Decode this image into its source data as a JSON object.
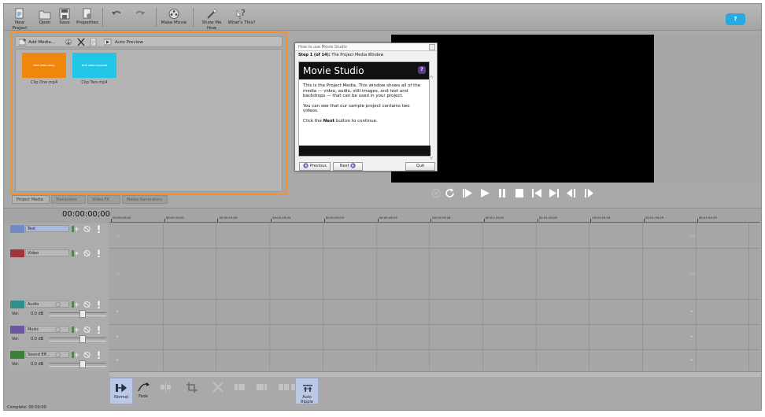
{
  "toolbar": {
    "buttons": [
      "New Project",
      "Open",
      "Save",
      "Properties",
      "",
      "",
      "Make Movie",
      "Show Me How",
      "What's This?"
    ],
    "help_badge": "?"
  },
  "media": {
    "add_media": "Add Media...",
    "auto_preview": "Auto Preview",
    "clips": [
      {
        "name": "Clip One.mp4",
        "thumb_text": "first video story",
        "color": "#f0870a"
      },
      {
        "name": "Clip Two.mp4",
        "thumb_text": "first video moment",
        "color": "#21c6e6"
      }
    ]
  },
  "tabs": [
    "Project Media",
    "Transitions",
    "Video FX",
    "Media Generators"
  ],
  "dialog": {
    "title": "How to use Movie Studio",
    "step_label": "Step 1 (of 14):",
    "step_name": "The Project Media Window",
    "banner": "Movie Studio",
    "banner_badge": "?",
    "para1": "This is the Project Media. This window shows all of the media — video, audio, still images, and text and backdrops — that can be used in your project.",
    "para2": "You can see that our sample project contains two videos.",
    "para3_pre": "Click the ",
    "para3_bold": "Next",
    "para3_post": " button to continue.",
    "prev_btn": "Previous",
    "next_btn": "Next",
    "quit_btn": "Quit"
  },
  "timeline": {
    "timecode": "00:00:00;00",
    "ticks": [
      "00:00:00;00",
      "00:00:15;00",
      "00:00:19;29",
      "00:00:29;29",
      "00:00:39;29",
      "00:00:49;29",
      "00:00:59;28",
      "00:01:15;00",
      "00:01:19;28",
      "00:01:29;29",
      "00:01:39;29",
      "00:01:49;29"
    ],
    "tracks": [
      {
        "name": "Text",
        "color": "#6f8cc8",
        "type": "video"
      },
      {
        "name": "Video",
        "color": "#a1343c",
        "type": "video"
      },
      {
        "name": "Audio",
        "color": "#2f8f8a",
        "type": "audio",
        "vol_label": "Vol:",
        "db": "0,0 dB"
      },
      {
        "name": "Music",
        "color": "#6b56a4",
        "type": "audio",
        "vol_label": "Vol:",
        "db": "0,0 dB"
      },
      {
        "name": "Sound Eff...",
        "color": "#3e7e3b",
        "type": "audio",
        "vol_label": "Vol:",
        "db": "0,0 dB"
      }
    ]
  },
  "edit_bar": {
    "buttons": [
      "Normal",
      "Fade",
      "",
      "",
      "",
      "",
      "",
      "",
      "",
      "Auto Ripple"
    ]
  },
  "status": "Complete: 00:00:00"
}
